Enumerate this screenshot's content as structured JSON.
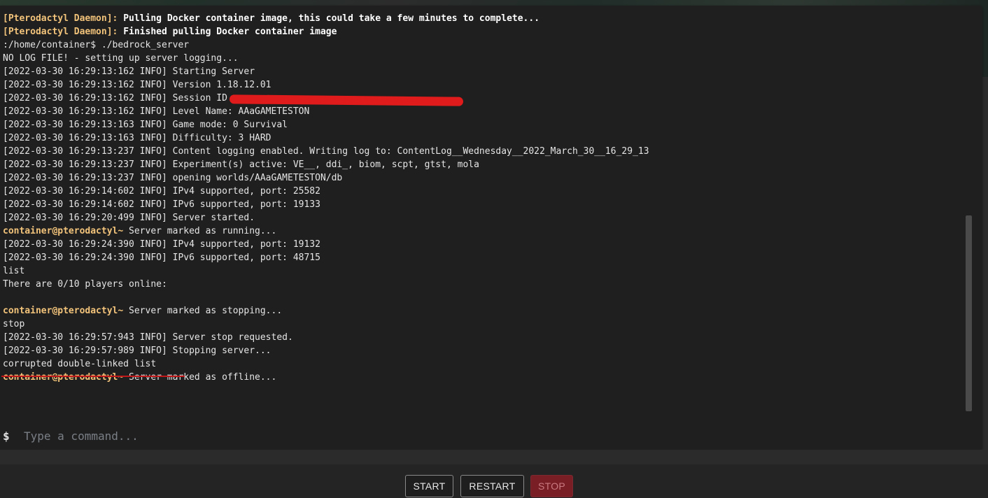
{
  "console": {
    "lines": [
      {
        "prefix": "[Pterodactyl Daemon]:",
        "text": " Pulling Docker container image, this could take a few minutes to complete...",
        "kind": "daemon"
      },
      {
        "prefix": "[Pterodactyl Daemon]:",
        "text": " Finished pulling Docker container image",
        "kind": "daemon"
      },
      {
        "prefix": "",
        "text": ":/home/container$ ./bedrock_server",
        "kind": "plain"
      },
      {
        "prefix": "",
        "text": "NO LOG FILE! - setting up server logging...",
        "kind": "plain"
      },
      {
        "prefix": "",
        "text": "[2022-03-30 16:29:13:162 INFO] Starting Server",
        "kind": "plain"
      },
      {
        "prefix": "",
        "text": "[2022-03-30 16:29:13:162 INFO] Version 1.18.12.01",
        "kind": "plain"
      },
      {
        "prefix": "",
        "text": "[2022-03-30 16:29:13:162 INFO] Session ID",
        "kind": "plain"
      },
      {
        "prefix": "",
        "text": "[2022-03-30 16:29:13:162 INFO] Level Name: AAaGAMETESTON",
        "kind": "plain"
      },
      {
        "prefix": "",
        "text": "[2022-03-30 16:29:13:163 INFO] Game mode: 0 Survival",
        "kind": "plain"
      },
      {
        "prefix": "",
        "text": "[2022-03-30 16:29:13:163 INFO] Difficulty: 3 HARD",
        "kind": "plain"
      },
      {
        "prefix": "",
        "text": "[2022-03-30 16:29:13:237 INFO] Content logging enabled. Writing log to: ContentLog__Wednesday__2022_March_30__16_29_13",
        "kind": "plain"
      },
      {
        "prefix": "",
        "text": "[2022-03-30 16:29:13:237 INFO] Experiment(s) active: VE__, ddi_, biom, scpt, gtst, mola",
        "kind": "plain"
      },
      {
        "prefix": "",
        "text": "[2022-03-30 16:29:13:237 INFO] opening worlds/AAaGAMETESTON/db",
        "kind": "plain"
      },
      {
        "prefix": "",
        "text": "[2022-03-30 16:29:14:602 INFO] IPv4 supported, port: 25582",
        "kind": "plain"
      },
      {
        "prefix": "",
        "text": "[2022-03-30 16:29:14:602 INFO] IPv6 supported, port: 19133",
        "kind": "plain"
      },
      {
        "prefix": "",
        "text": "[2022-03-30 16:29:20:499 INFO] Server started.",
        "kind": "plain"
      },
      {
        "prefix": "container@pterodactyl~",
        "text": " Server marked as running...",
        "kind": "prompt"
      },
      {
        "prefix": "",
        "text": "[2022-03-30 16:29:24:390 INFO] IPv4 supported, port: 19132",
        "kind": "plain"
      },
      {
        "prefix": "",
        "text": "[2022-03-30 16:29:24:390 INFO] IPv6 supported, port: 48715",
        "kind": "plain"
      },
      {
        "prefix": "",
        "text": "list",
        "kind": "plain"
      },
      {
        "prefix": "",
        "text": "There are 0/10 players online:",
        "kind": "plain"
      },
      {
        "prefix": "",
        "text": "",
        "kind": "plain"
      },
      {
        "prefix": "container@pterodactyl~",
        "text": " Server marked as stopping...",
        "kind": "prompt"
      },
      {
        "prefix": "",
        "text": "stop",
        "kind": "plain"
      },
      {
        "prefix": "",
        "text": "[2022-03-30 16:29:57:943 INFO] Server stop requested.",
        "kind": "plain"
      },
      {
        "prefix": "",
        "text": "[2022-03-30 16:29:57:989 INFO] Stopping server...",
        "kind": "plain"
      },
      {
        "prefix": "",
        "text": "corrupted double-linked list",
        "kind": "plain"
      },
      {
        "prefix": "container@pterodactyl~",
        "text": " Server marked as offline...",
        "kind": "prompt"
      }
    ]
  },
  "command": {
    "prompt_symbol": "$",
    "placeholder": "Type a command..."
  },
  "controls": {
    "start_label": "START",
    "restart_label": "RESTART",
    "stop_label": "STOP"
  },
  "colors": {
    "daemon_prefix": "#f2c37a",
    "prompt_user": "#f2c37a",
    "log_text": "#e5e5e5",
    "stop_button": "#7a1e26",
    "annotation_red": "#e01b1b"
  }
}
